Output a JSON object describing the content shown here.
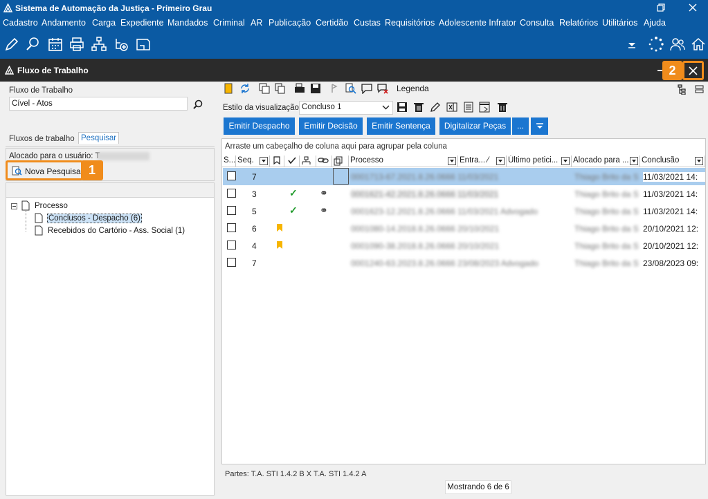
{
  "window": {
    "title": "Sistema de Automação da Justiça - Primeiro Grau"
  },
  "menu": [
    "Cadastro",
    "Andamento",
    "Carga",
    "Expediente",
    "Mandados",
    "Criminal",
    "AR",
    "Publicação",
    "Certidão",
    "Custas",
    "Requisitórios",
    "Adolescente Infrator",
    "Consulta",
    "Relatórios",
    "Utilitários",
    "Ajuda"
  ],
  "panel": {
    "title": "Fluxo de Trabalho"
  },
  "callouts": {
    "one": "1",
    "two": "2"
  },
  "left": {
    "fluxo_label": "Fluxo de Trabalho",
    "fluxo_value": "Cível - Atos",
    "tabs": [
      "Fluxos de trabalho",
      "Pesquisar"
    ],
    "alocado_label": "Alocado para o usuário: T",
    "nova_pesquisa": "Nova Pesquisa",
    "tree": {
      "root": "Processo",
      "items": [
        "Conclusos - Despacho (6)",
        "Recebidos do Cartório - Ass. Social (1)"
      ]
    }
  },
  "right": {
    "legenda": "Legenda",
    "estilo_label": "Estilo da visualização",
    "estilo_value": "Concluso 1",
    "buttons": [
      "Emitir Despacho",
      "Emitir Decisão",
      "Emitir Sentença",
      "Digitalizar Peças",
      "..."
    ],
    "group_hint": "Arraste um cabeçalho de coluna aqui para agrupar pela coluna",
    "columns": [
      "S...",
      "Seq.",
      "",
      "",
      "",
      "",
      "",
      "Processo",
      "Entra... ⁄",
      "Último petici...",
      "Alocado para ...",
      "Conclusão"
    ],
    "rows": [
      {
        "seq": "7",
        "check": "",
        "link": "",
        "bookmark": false,
        "processo": "0001713-67.2021.8.26.0666 11/03/2021",
        "alocado": "Thiago Brito da S",
        "conclusao": "11/03/2021 14:"
      },
      {
        "seq": "3",
        "check": "✓",
        "link": "⚭",
        "bookmark": false,
        "processo": "0001621-42.2021.8.26.0666 11/03/2021",
        "alocado": "Thiago Brito da S",
        "conclusao": "11/03/2021 14:"
      },
      {
        "seq": "5",
        "check": "✓",
        "link": "⚭",
        "bookmark": false,
        "processo": "0001623-12.2021.8.26.0666 11/03/2021 Advogado",
        "alocado": "Thiago Brito da S",
        "conclusao": "11/03/2021 14:"
      },
      {
        "seq": "6",
        "check": "",
        "link": "",
        "bookmark": true,
        "processo": "0001080-14.2018.8.26.0666 20/10/2021",
        "alocado": "Thiago Brito da S",
        "conclusao": "20/10/2021 12:"
      },
      {
        "seq": "4",
        "check": "",
        "link": "",
        "bookmark": true,
        "processo": "0001090-38.2018.8.26.0666 20/10/2021",
        "alocado": "Thiago Brito da S",
        "conclusao": "20/10/2021 12:"
      },
      {
        "seq": "7",
        "check": "",
        "link": "",
        "bookmark": false,
        "processo": "0001240-63.2023.8.26.0666 23/08/2023 Advogado",
        "alocado": "Thiago Brito da S",
        "conclusao": "23/08/2023 09:"
      }
    ],
    "partes": "Partes: T.A. STI 1.4.2 B  X  T.A. STI 1.4.2 A",
    "mostrando": "Mostrando 6 de 6"
  },
  "colors": {
    "brand": "#0b5aa3",
    "button": "#1b76d0",
    "selected_row": "#a9cdee",
    "callout": "#f08c1c"
  }
}
